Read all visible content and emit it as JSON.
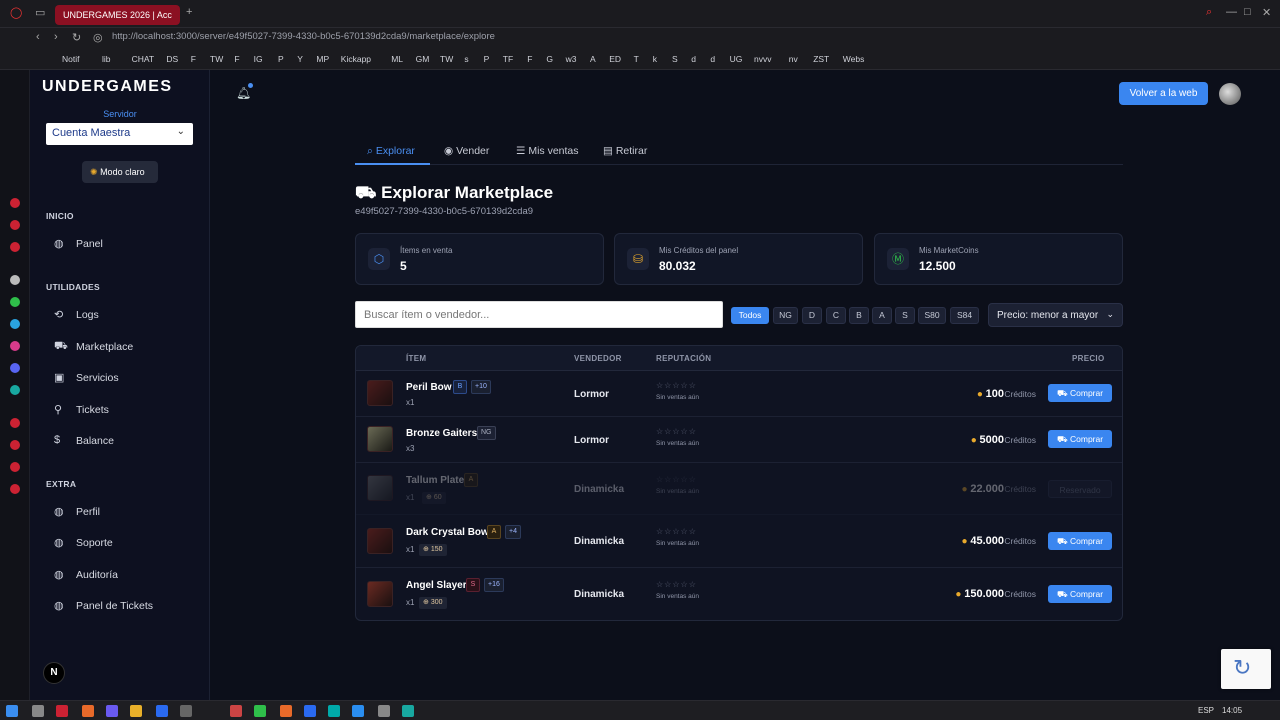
{
  "browser": {
    "tab_title": "UNDERGAMES 2026 | Acc",
    "url": "http://localhost:3000/server/e49f5027-7399-4330-b0c5-670139d2cda9/marketplace/explore",
    "bookmarks": [
      "Notif",
      "lib",
      "CHAT",
      "DS",
      "F",
      "TW",
      "F",
      "IG",
      "P",
      "Y",
      "MP",
      "Kickapp",
      "ML",
      "GM",
      "TW",
      "s",
      "P",
      "TF",
      "F",
      "G",
      "w3",
      "A",
      "ED",
      "T",
      "k",
      "S",
      "d",
      "d",
      "UG",
      "nvvv",
      "nv",
      "ZST",
      "Webs"
    ]
  },
  "sidebar": {
    "logo": "UNDERGAMES",
    "server_label": "Servidor",
    "server_value": "Cuenta Maestra",
    "mode_button": "Modo claro",
    "sections": {
      "inicio": "INICIO",
      "utilidades": "UTILIDADES",
      "extra": "EXTRA"
    },
    "items": {
      "panel": "Panel",
      "logs": "Logs",
      "marketplace": "Marketplace",
      "servicios": "Servicios",
      "tickets": "Tickets",
      "balance": "Balance",
      "perfil": "Perfil",
      "soporte": "Soporte",
      "auditoria": "Auditoría",
      "panel_tickets": "Panel de Tickets"
    },
    "badge": "N"
  },
  "header": {
    "back_button": "Volver a la web"
  },
  "tabs": [
    "Explorar",
    "Vender",
    "Mis ventas",
    "Retirar"
  ],
  "page": {
    "title": "Explorar Marketplace",
    "subtitle": "e49f5027-7399-4330-b0c5-670139d2cda9"
  },
  "stats": [
    {
      "label": "Ítems en venta",
      "value": "5"
    },
    {
      "label": "Mis Créditos del panel",
      "value": "80.032"
    },
    {
      "label": "Mis MarketCoins",
      "value": "12.500"
    }
  ],
  "search": {
    "placeholder": "Buscar ítem o vendedor..."
  },
  "filters": [
    "Todos",
    "NG",
    "D",
    "C",
    "B",
    "A",
    "S",
    "S80",
    "S84"
  ],
  "sort": {
    "value": "Precio: menor a mayor"
  },
  "table": {
    "headers": {
      "item": "ÍTEM",
      "seller": "VENDEDOR",
      "rep": "REPUTACIÓN",
      "price": "PRECIO"
    },
    "no_sales": "Sin ventas aún",
    "credits_label": "Créditos",
    "rows": [
      {
        "name": "Peril Bow",
        "grade": "B",
        "enchant": "+10",
        "qty": "x1",
        "pvp": "",
        "seller": "Lormor",
        "price": "100",
        "action": "Comprar"
      },
      {
        "name": "Bronze Gaiters",
        "grade": "NG",
        "enchant": "",
        "qty": "x3",
        "pvp": "",
        "seller": "Lormor",
        "price": "5000",
        "action": "Comprar"
      },
      {
        "name": "Tallum Plate",
        "grade": "A",
        "enchant": "",
        "qty": "x1",
        "pvp": "60",
        "seller": "Dinamicka",
        "price": "22.000",
        "action": "Reservado"
      },
      {
        "name": "Dark Crystal Bow",
        "grade": "A",
        "enchant": "+4",
        "qty": "x1",
        "pvp": "150",
        "seller": "Dinamicka",
        "price": "45.000",
        "action": "Comprar"
      },
      {
        "name": "Angel Slayer",
        "grade": "S",
        "enchant": "+16",
        "qty": "x1",
        "pvp": "300",
        "seller": "Dinamicka",
        "price": "150.000",
        "action": "Comprar"
      }
    ]
  },
  "taskbar": {
    "lang": "ESP",
    "time": "14:05"
  },
  "colors": {
    "accent": "#3a86f0",
    "bg": "#0c0f1a",
    "coin": "#e8a92c"
  }
}
